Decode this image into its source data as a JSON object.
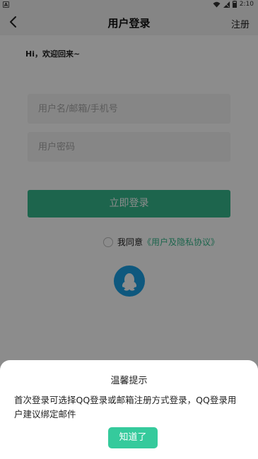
{
  "status_bar": {
    "left_icon": "A",
    "time": "2:10",
    "icons": [
      "wifi-icon",
      "signal-icon",
      "battery-icon"
    ]
  },
  "header": {
    "title": "用户登录",
    "register_label": "注册"
  },
  "greeting": "Hi，欢迎回来~",
  "form": {
    "username_placeholder": "用户名/邮箱/手机号",
    "password_placeholder": "用户密码",
    "login_label": "立即登录"
  },
  "agreement": {
    "prefix": "我同意",
    "link_text": "《用户及隐私协议》",
    "checked": false
  },
  "social": {
    "qq_icon": "qq-penguin-icon"
  },
  "dialog": {
    "title": "温馨提示",
    "message": "首次登录可选择QQ登录或邮箱注册方式登录，QQ登录用户建议绑定邮件",
    "ok_label": "知道了"
  },
  "colors": {
    "accent": "#35b98c",
    "dialog_button": "#35ca9c",
    "qq_blue": "#1aa0e6",
    "overlay": "rgba(0,0,0,0.45)"
  }
}
